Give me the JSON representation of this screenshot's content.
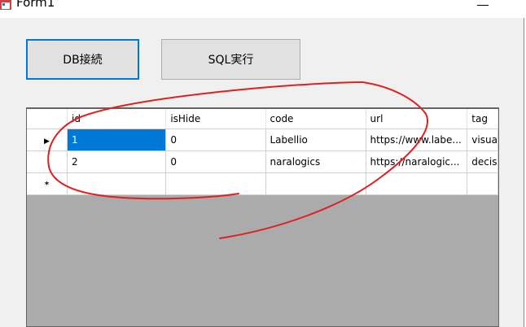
{
  "window": {
    "title": "Form1"
  },
  "buttons": {
    "db_connect": "DB接続",
    "sql_execute": "SQL実行"
  },
  "grid": {
    "columns": [
      "id",
      "isHide",
      "code",
      "url",
      "tag"
    ],
    "rows": [
      {
        "id": "1",
        "isHide": "0",
        "code": "Labellio",
        "url": "https://www.labe...",
        "tag": "visua"
      },
      {
        "id": "2",
        "isHide": "0",
        "code": "naralogics",
        "url": "https://naralogic...",
        "tag": "decis"
      }
    ],
    "current_row_marker": "▶",
    "new_row_marker": "*"
  },
  "colors": {
    "selection": "#0078d7",
    "focus_border": "#0078d7",
    "annotation": "#e02020",
    "grid_background": "#ababab"
  }
}
